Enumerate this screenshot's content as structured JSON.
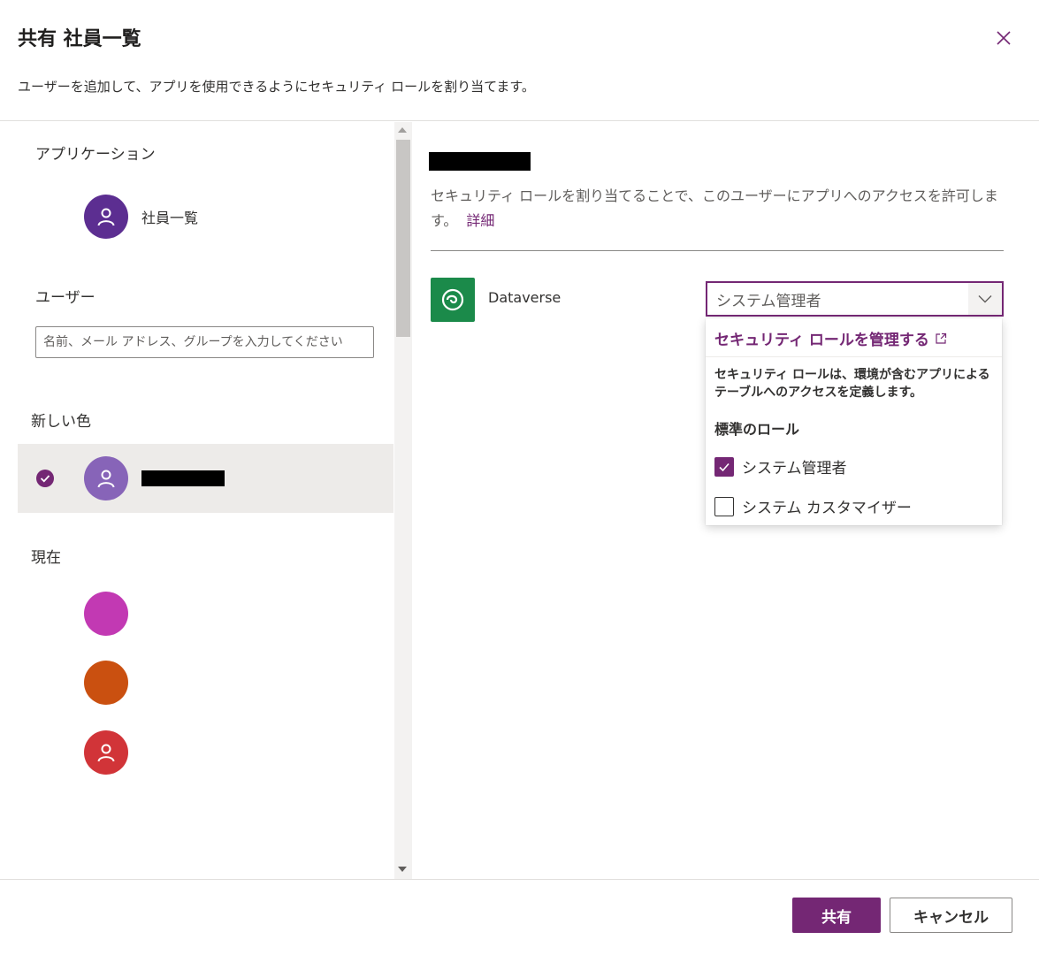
{
  "header": {
    "title": "共有 社員一覧",
    "subtitle": "ユーザーを追加して、アプリを使用できるようにセキュリティ ロールを割り当てます。"
  },
  "left": {
    "app_section_label": "アプリケーション",
    "app_name": "社員一覧",
    "users_section_label": "ユーザー",
    "search_placeholder": "名前、メール アドレス、グループを入力してください",
    "new_section_label": "新しい色",
    "current_section_label": "現在",
    "current_avatars": [
      {
        "color": "#c239b3"
      },
      {
        "color": "#ca5010"
      },
      {
        "color": "#d13438"
      }
    ],
    "app_avatar_color": "#5c2e91",
    "new_user_avatar_color": "#8764b8"
  },
  "right": {
    "description": "セキュリティ ロールを割り当てることで、このユーザーにアプリへのアクセスを許可します。",
    "details_link": "詳細",
    "connector_name": "Dataverse",
    "dropdown_value": "システム管理者",
    "menu": {
      "manage_link": "セキュリティ ロールを管理する",
      "info": "セキュリティ ロールは、環境が含むアプリによるテーブルへのアクセスを定義します。",
      "group_label": "標準のロール",
      "options": [
        {
          "label": "システム管理者",
          "checked": true
        },
        {
          "label": "システム カスタマイザー",
          "checked": false
        }
      ]
    }
  },
  "footer": {
    "share_label": "共有",
    "cancel_label": "キャンセル"
  },
  "colors": {
    "accent": "#742774",
    "dataverse_green": "#1b8a4a"
  }
}
